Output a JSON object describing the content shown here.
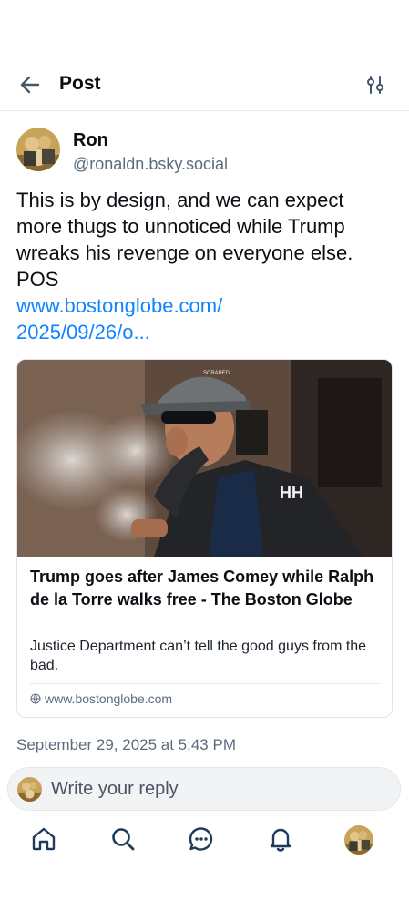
{
  "header": {
    "title": "Post",
    "back_icon": "arrow-left-icon",
    "filter_icon": "sliders-icon"
  },
  "post": {
    "author_name": "Ron",
    "author_handle": "@ronaldn.bsky.social",
    "text": "This is by design, and we can expect more thugs to unnoticed while Trump wreaks his revenge on everyone else. POS",
    "link_line1": "www.bostonglobe.com/",
    "link_line2": "2025/09/26/o...",
    "timestamp": "September 29, 2025 at 5:43 PM"
  },
  "link_card": {
    "title": "Trump goes after James Comey while Ralph de la Torre walks free - The Boston Globe",
    "description": "Justice Department can’t tell the good guys from the bad.",
    "domain": "www.bostonglobe.com",
    "image_cap_text": "SCRAPED",
    "jacket_logo": "HH"
  },
  "reply": {
    "placeholder": "Write your reply"
  },
  "tabbar": {
    "items": [
      "home-icon",
      "search-icon",
      "chat-icon",
      "bell-icon",
      "profile-avatar"
    ]
  },
  "colors": {
    "link": "#1083fe",
    "muted": "#5d6c7d",
    "text": "#0b0f14",
    "icon": "#1f3a5a"
  }
}
